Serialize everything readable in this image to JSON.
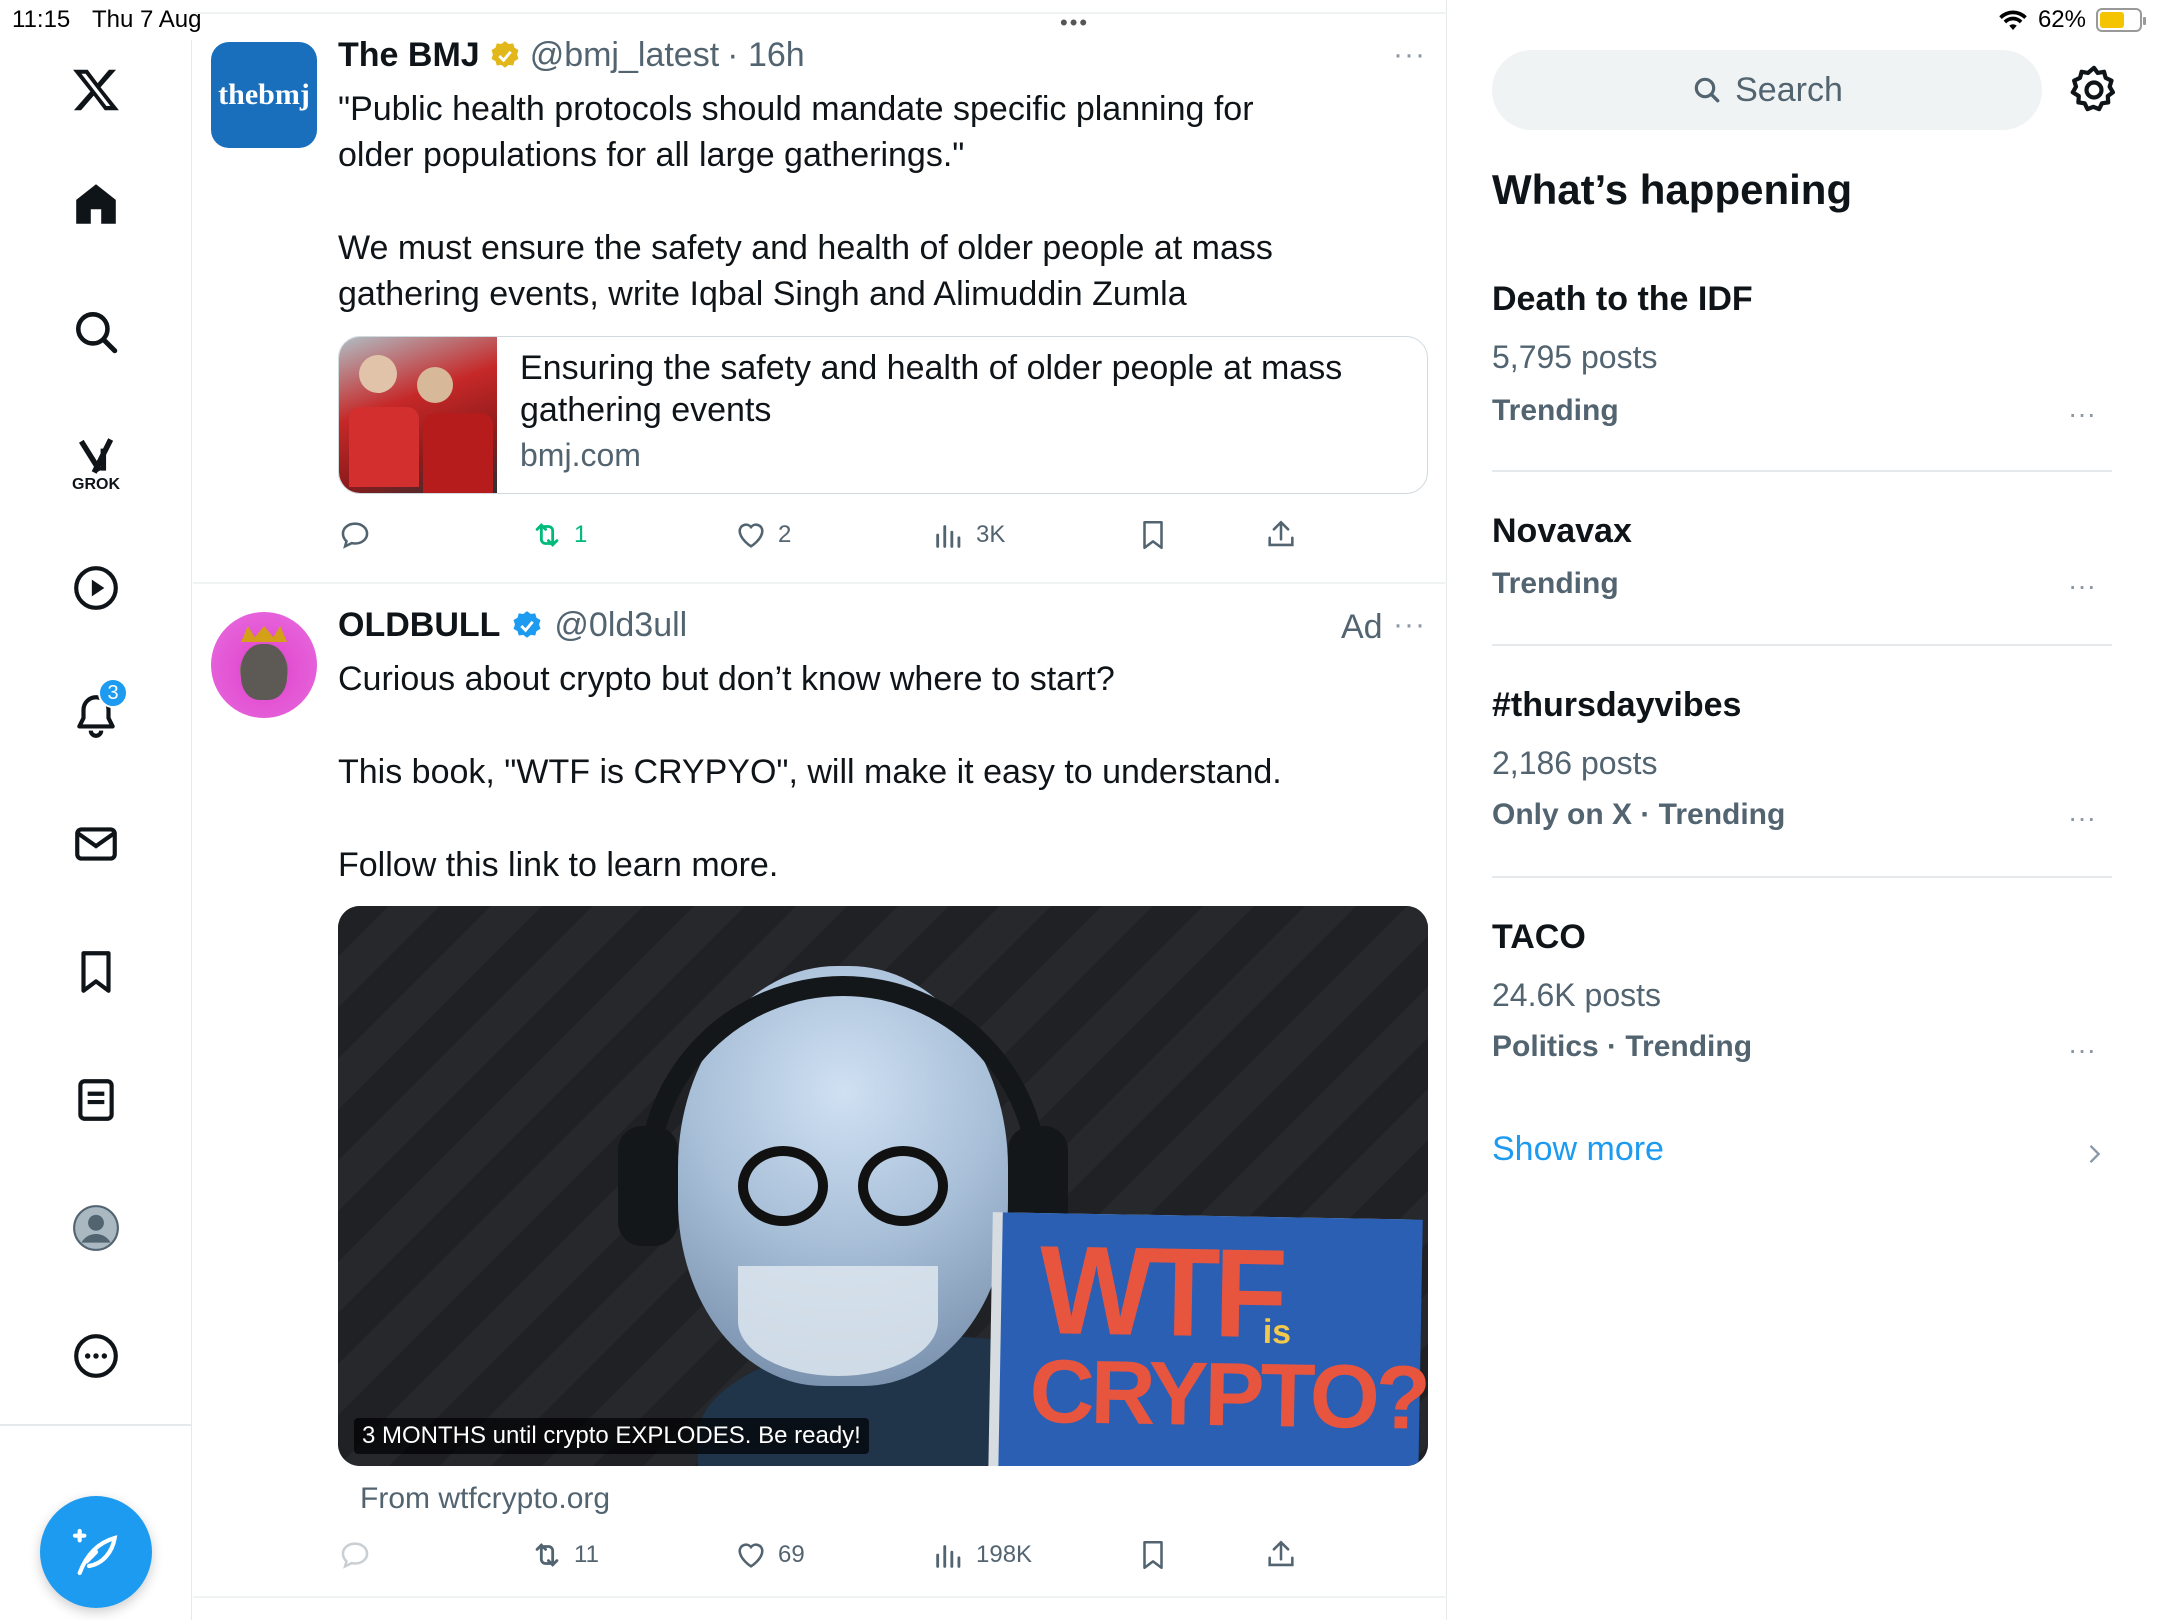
{
  "status": {
    "time": "11:15",
    "date": "Thu 7 Aug",
    "battery": "62%",
    "battery_level": 0.62
  },
  "nav": {
    "grok_label": "GROK",
    "notifications_count": "3"
  },
  "posts": [
    {
      "name": "The BMJ",
      "handle": "@bmj_latest",
      "time": "· 16h",
      "avatar_text": "thebmj",
      "text1": "\"Public health protocols should mandate specific planning for older populations for all large gatherings.\"",
      "text2": "We must ensure the safety and health of older people at mass gathering events, write Iqbal Singh and Alimuddin Zumla",
      "card_title": "Ensuring the safety and health of older people at mass gathering events",
      "card_domain": "bmj.com",
      "reposts": "1",
      "likes": "2",
      "views": "3K"
    },
    {
      "name": "OLDBULL",
      "handle": "@0ld3ull",
      "ad_label": "Ad",
      "text1": "Curious about crypto but don’t know where to start?",
      "text2": "This book, \"WTF is CRYPYO\", will make it easy to understand.",
      "text3": "Follow this link to learn more.",
      "video_caption": "3 MONTHS until crypto EXPLODES. Be ready!",
      "book_line1": "WTF",
      "book_is": "is",
      "book_line2": "CRYPTO?",
      "from": "From wtfcrypto.org",
      "reposts": "11",
      "likes": "69",
      "views": "198K"
    }
  ],
  "sidebar": {
    "search_placeholder": "Search",
    "heading": "What’s happening",
    "trends": [
      {
        "title": "Death to the IDF",
        "posts": "5,795 posts",
        "meta": "Trending"
      },
      {
        "title": "Novavax",
        "posts": "",
        "meta": "Trending"
      },
      {
        "title": "#thursdayvibes",
        "posts": "2,186 posts",
        "meta": "Only on X · Trending"
      },
      {
        "title": "TACO",
        "posts": "24.6K posts",
        "meta": "Politics · Trending"
      }
    ],
    "show_more": "Show more"
  },
  "colors": {
    "accent": "#1d9bf0",
    "repost_green": "#00ba7c",
    "muted": "#536471"
  }
}
